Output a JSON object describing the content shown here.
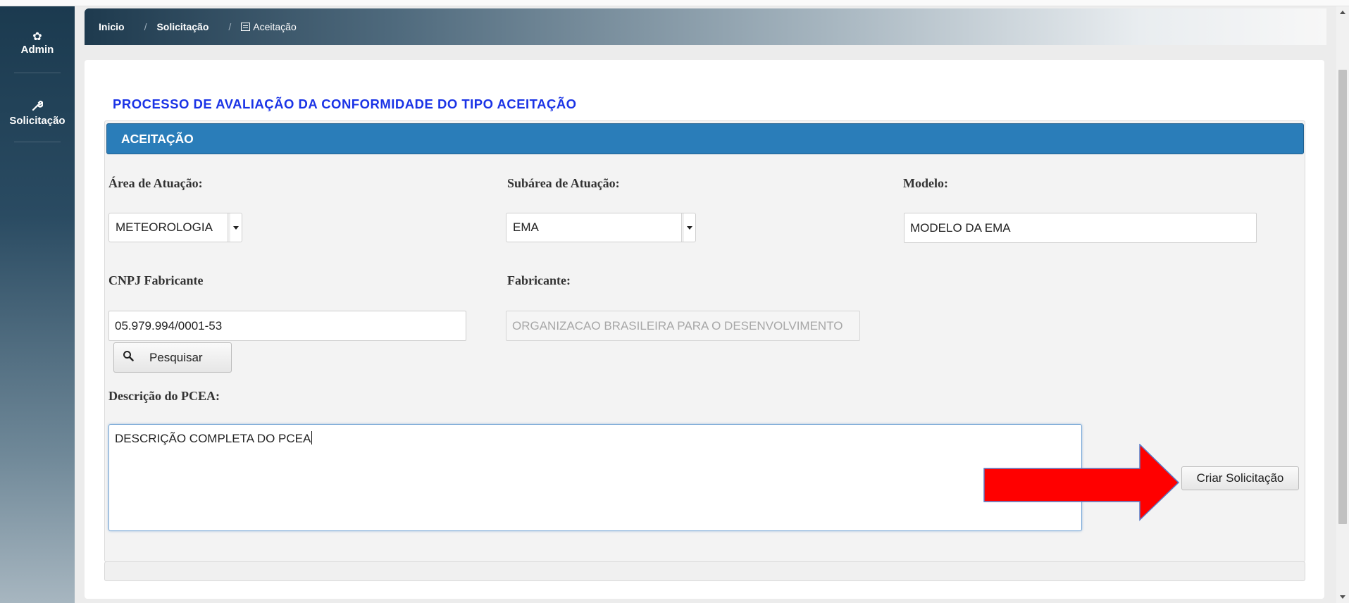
{
  "sidebar": {
    "items": [
      {
        "label": "Admin",
        "icon": "gear-icon"
      },
      {
        "label": "Solicitação",
        "icon": "wrench-icon"
      }
    ]
  },
  "breadcrumb": {
    "items": [
      "Inicio",
      "Solicitação",
      "Aceitação"
    ],
    "separator": "/"
  },
  "page": {
    "title": "PROCESSO DE AVALIAÇÃO DA CONFORMIDADE DO TIPO ACEITAÇÃO"
  },
  "section": {
    "header": "ACEITAÇÃO"
  },
  "form": {
    "area_label": "Área de Atuação:",
    "area_value": "METEOROLOGIA",
    "subarea_label": "Subárea de Atuação:",
    "subarea_value": "EMA",
    "modelo_label": "Modelo:",
    "modelo_value": "MODELO DA EMA",
    "cnpj_label": "CNPJ Fabricante",
    "cnpj_value": "05.979.994/0001-53",
    "fabricante_label": "Fabricante:",
    "fabricante_value": "ORGANIZACAO BRASILEIRA PARA O DESENVOLVIMENTO",
    "search_button": "Pesquisar",
    "descricao_label": "Descrição do PCEA:",
    "descricao_value": "DESCRIÇÃO COMPLETA DO PCEA",
    "submit_button": "Criar Solicitação"
  },
  "colors": {
    "title": "#1a33e6",
    "section_header": "#2a7db9",
    "annotation_arrow": "#ff0000"
  }
}
